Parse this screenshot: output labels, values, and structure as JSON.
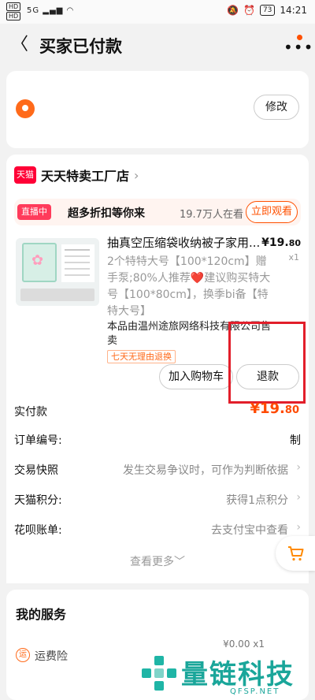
{
  "status_bar": {
    "sim1": "HD",
    "sim2": "HD",
    "signal": "5G",
    "battery": "73",
    "time": "14:21"
  },
  "nav": {
    "title": "买家已付款"
  },
  "address": {
    "edit_label": "修改"
  },
  "shop": {
    "badge": "天猫",
    "name": "天天特卖工厂店"
  },
  "live": {
    "tag": "直播中",
    "text": "超多折扣等你来",
    "viewers": "19.7万人在看",
    "button": "立即观看"
  },
  "product": {
    "title": "抽真空压缩袋收纳被子家用...",
    "sku": "2个特特大号【100*120cm】赠手泵;80%人推荐❤️建议购买特大号【100*80cm】，换季bi备【特特大号】",
    "price_int": "¥19.",
    "price_dec": "80",
    "qty": "x1",
    "seller": "本品由温州途旅网络科技有限公司售卖",
    "return_tag": "七天无理由退换"
  },
  "actions": {
    "cart": "加入购物车",
    "refund": "退款"
  },
  "rows": {
    "paid_label": "实付款",
    "paid_int": "¥19.",
    "paid_dec": "80",
    "order_label": "订单编号:",
    "order_value": "制",
    "snapshot_label": "交易快照",
    "snapshot_value": "发生交易争议时，可作为判断依据",
    "points_label": "天猫积分:",
    "points_value": "获得1点积分",
    "huabei_label": "花呗账单:",
    "huabei_value": "去支付宝中查看"
  },
  "see_more": "查看更多",
  "services": {
    "title": "我的服务",
    "freight_icon": "运",
    "freight_label": "运费险",
    "freight_price": "¥0.00 x1"
  },
  "watermark": {
    "text": "量链科技",
    "sub": "QFSP.NET"
  }
}
